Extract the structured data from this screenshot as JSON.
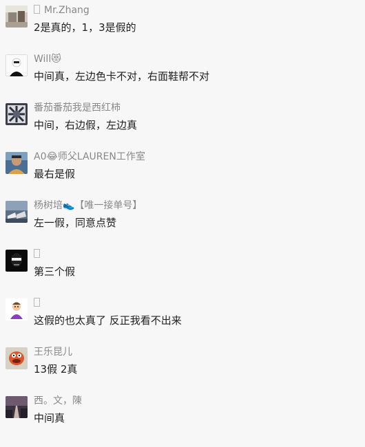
{
  "comments": [
    {
      "name": "Mr.Zhang",
      "text": "2是真的，1，3是假的",
      "name_mark": true,
      "avatar": "photo-room-avatar-icon"
    },
    {
      "name": "Will😻",
      "text": "中间真，左边色卡不对，右面鞋帮不对",
      "name_mark": false,
      "avatar": "white-masked-person-avatar-icon"
    },
    {
      "name": "番茄番茄我是西红柿",
      "text": "中间，右边假，左边真",
      "name_mark": false,
      "avatar": "dark-pattern-avatar-icon"
    },
    {
      "name": "A0😂师父LAUREN工作室",
      "text": "最右是假",
      "name_mark": false,
      "avatar": "man-portrait-avatar-icon"
    },
    {
      "name": "杨树培👟【唯一接单号】",
      "text": "左一假，同意点赞",
      "name_mark": false,
      "avatar": "sneakers-avatar-icon"
    },
    {
      "name": "",
      "text": "第三个假",
      "name_mark": true,
      "avatar": "black-masked-face-avatar-icon"
    },
    {
      "name": "",
      "text": "这假的也太真了 反正我看不出来",
      "name_mark": true,
      "avatar": "purple-cartoon-avatar-icon"
    },
    {
      "name": "王乐昆儿",
      "text": "13假   2真",
      "name_mark": false,
      "avatar": "red-puppet-avatar-icon"
    },
    {
      "name": "西。文，陳",
      "text": "中间真",
      "name_mark": false,
      "avatar": "night-road-avatar-icon"
    }
  ],
  "colors": {
    "background": "#f7f7f7",
    "name_text": "#888888",
    "comment_text": "#1f1f1f"
  }
}
